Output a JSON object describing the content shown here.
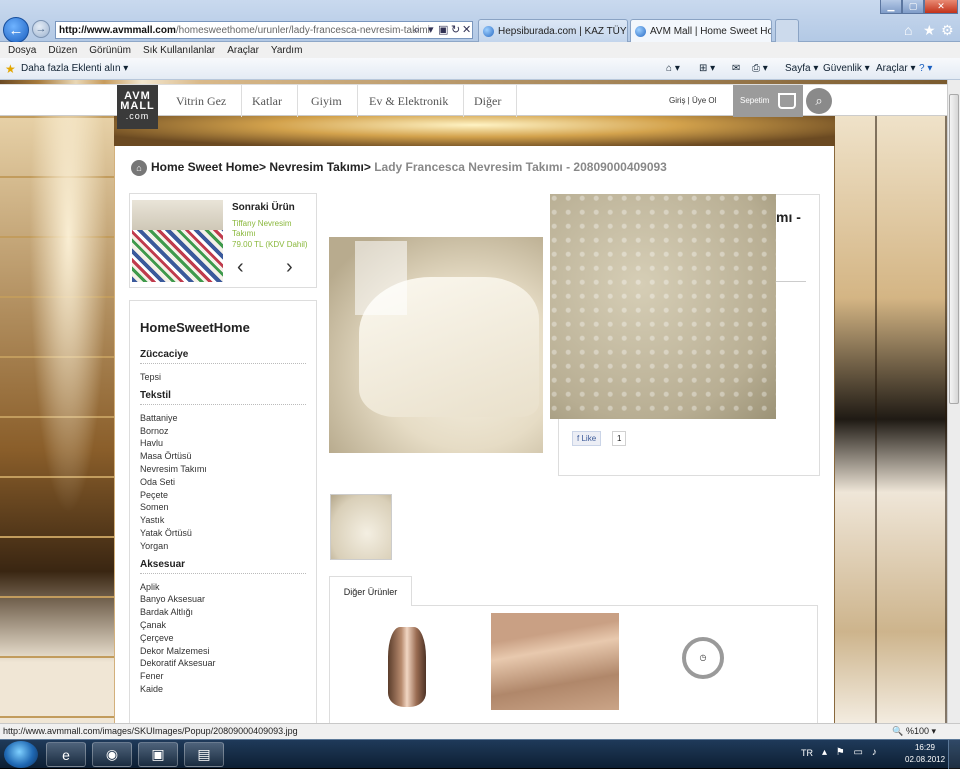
{
  "browser": {
    "address_domain": "http://www.avmmall.com",
    "address_path": "/homesweethome/urunler/lady-francesca-nevresim-takimi",
    "tabs": [
      {
        "label": "Hepsiburada.com | KAZ TÜYÜ ..."
      },
      {
        "label": "AVM Mall | Home Sweet Ho..."
      }
    ],
    "menu": [
      "Dosya",
      "Düzen",
      "Görünüm",
      "Sık Kullanılanlar",
      "Araçlar",
      "Yardım"
    ],
    "favorites_addon": "Daha fazla Eklenti alın",
    "command_items": [
      "Sayfa",
      "Güvenlik",
      "Araçlar"
    ],
    "status_url": "http://www.avmmall.com/images/SKUImages/Popup/20809000409093.jpg",
    "zoom": "%100"
  },
  "site": {
    "logo_line1": "AVM",
    "logo_line2": "MALL",
    "logo_line3": ".com",
    "nav": [
      "Vitrin Gez",
      "Katlar",
      "Giyim",
      "Ev & Elektronik",
      "Diğer"
    ],
    "login": "Giriş",
    "signup": "Üye Ol",
    "cart_label": "Sepetim"
  },
  "breadcrumb": {
    "home": "Home Sweet Home",
    "category": "Nevresim Takımı",
    "current": "Lady Francesca Nevresim Takımı - 20809000409093"
  },
  "next_product": {
    "title": "Sonraki Ürün",
    "name": "Tiffany Nevresim Takımı",
    "price": "79.00 TL (KDV Dahil)"
  },
  "categories": {
    "title": "HomeSweetHome",
    "groups": [
      {
        "name": "Züccaciye",
        "items": [
          "Tepsi"
        ]
      },
      {
        "name": "Tekstil",
        "items": [
          "Battaniye",
          "Bornoz",
          "Havlu",
          "Masa Örtüsü",
          "Nevresim Takımı",
          "Oda Seti",
          "Peçete",
          "Somen",
          "Yastık",
          "Yatak Örtüsü",
          "Yorgan"
        ]
      },
      {
        "name": "Aksesuar",
        "items": [
          "Aplik",
          "Banyo Aksesuar",
          "Bardak Altlığı",
          "Çanak",
          "Çerçeve",
          "Dekor Malzemesi",
          "Dekoratif Aksesuar",
          "Fener",
          "Kaide"
        ]
      }
    ]
  },
  "product": {
    "title_fragment": "mı -",
    "like_label": "Like",
    "like_count": "1"
  },
  "other_products": {
    "tab_label": "Diğer Ürünler"
  },
  "taskbar": {
    "lang": "TR",
    "time": "16:29",
    "date": "02.08.2012"
  }
}
